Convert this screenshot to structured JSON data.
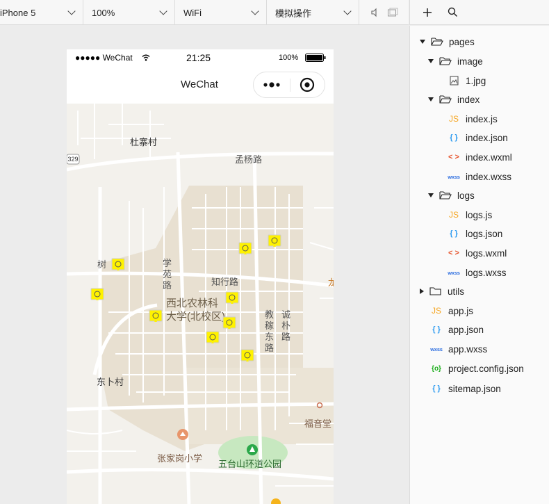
{
  "toolbar": {
    "device": "iPhone 5",
    "zoom": "100%",
    "network": "WiFi",
    "mode": "模拟操作",
    "icons": [
      "speaker-icon",
      "window-icon"
    ]
  },
  "right_toolbar": {
    "icons": [
      "plus-icon",
      "search-icon"
    ]
  },
  "file_tree": {
    "pages": "pages",
    "image": "image",
    "image_file": "1.jpg",
    "index": "index",
    "index_js": "index.js",
    "index_json": "index.json",
    "index_wxml": "index.wxml",
    "index_wxss": "index.wxss",
    "logs": "logs",
    "logs_js": "logs.js",
    "logs_json": "logs.json",
    "logs_wxml": "logs.wxml",
    "logs_wxss": "logs.wxss",
    "utils": "utils",
    "app_js": "app.js",
    "app_json": "app.json",
    "app_wxss": "app.wxss",
    "project_config": "project.config.json",
    "sitemap": "sitemap.json",
    "icon_labels": {
      "js": "JS",
      "json": "{ }",
      "wxml": "< >",
      "wxss": "wxss",
      "config": "{o}"
    }
  },
  "simulator": {
    "carrier": "●●●●● WeChat",
    "time": "21:25",
    "battery": "100%",
    "nav_title": "WeChat"
  },
  "map": {
    "labels": {
      "duzhai": "杜寨村",
      "mengyang": "孟杨路",
      "shu": "树",
      "xueyuan": "学\n苑\n路",
      "zhixing": "知行路",
      "campus1": "西北农林科",
      "campus2": "大学(北校区)",
      "jiaojia": "教\n稼\n东\n路",
      "chengpu": "诚\n朴\n路",
      "dongbu": "东卜村",
      "fuyin": "福音堂",
      "zhangjiagang": "张家岗小学",
      "wutaishan": "五台山环道公园",
      "road_num": "329",
      "edge": "龙"
    },
    "colors": {
      "campus": "#e7dfd0",
      "park": "#c7e8c0",
      "road": "#ffffff",
      "marker": "#fff200"
    }
  }
}
